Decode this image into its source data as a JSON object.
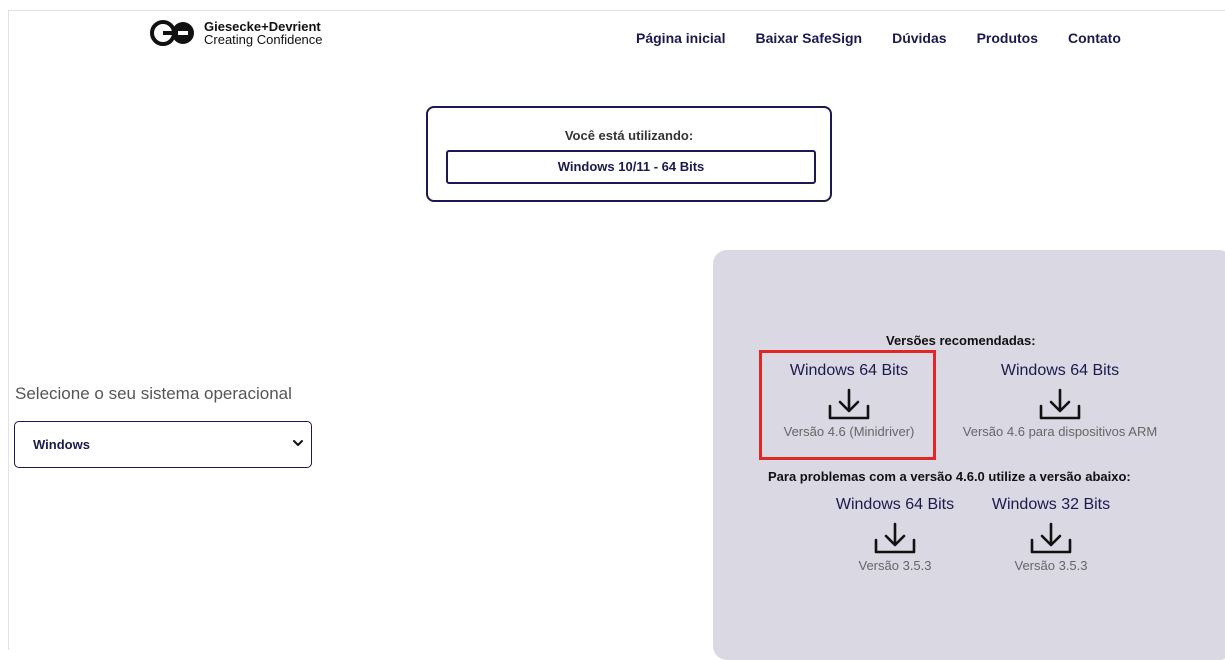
{
  "brand": {
    "name": "Giesecke+Devrient",
    "tagline": "Creating Confidence"
  },
  "nav": {
    "items": [
      "Página inicial",
      "Baixar SafeSign",
      "Dúvidas",
      "Produtos",
      "Contato"
    ]
  },
  "using": {
    "label": "Você está utilizando:",
    "value": "Windows 10/11 - 64 Bits"
  },
  "os_select": {
    "label": "Selecione o seu sistema operacional",
    "selected": "Windows"
  },
  "recommended": {
    "title": "Versões recomendadas:",
    "items": [
      {
        "title": "Windows 64 Bits",
        "version": "Versão 4.6 (Minidriver)",
        "icon": "download-icon"
      },
      {
        "title": "Windows 64 Bits",
        "version": "Versão 4.6 para dispositivos ARM",
        "icon": "download-icon"
      }
    ]
  },
  "fallback": {
    "title": "Para problemas com a versão 4.6.0 utilize a versão abaixo:",
    "items": [
      {
        "title": "Windows 64 Bits",
        "version": "Versão 3.5.3",
        "icon": "download-icon"
      },
      {
        "title": "Windows 32 Bits",
        "version": "Versão 3.5.3",
        "icon": "download-icon"
      }
    ]
  },
  "colors": {
    "brand_navy": "#1b1a4d",
    "panel_bg": "#d9d8e3",
    "highlight": "#e02727"
  }
}
